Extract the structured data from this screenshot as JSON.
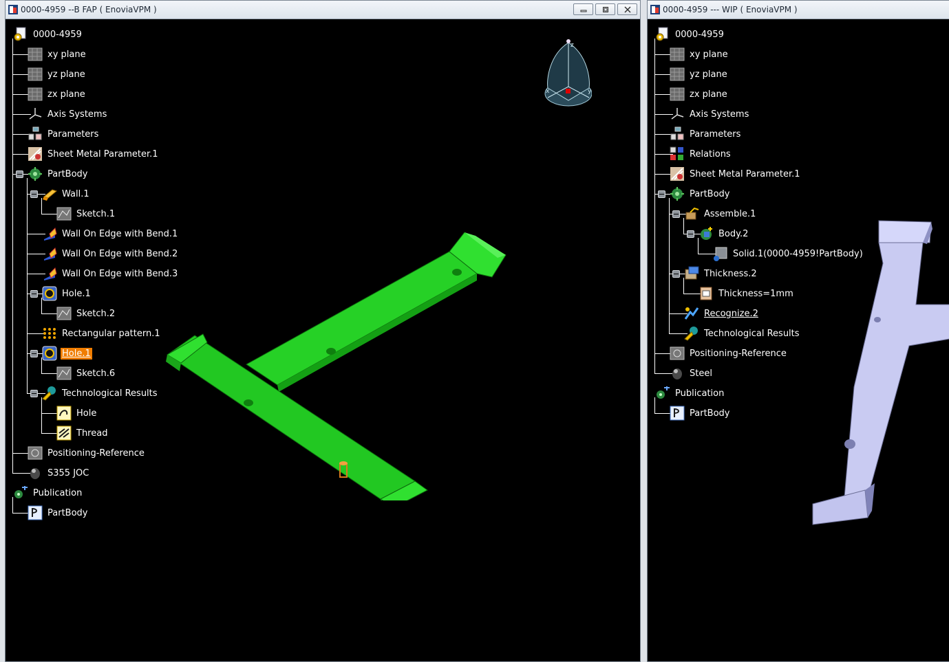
{
  "left_window": {
    "title": "0000-4959 --B FAP ( EnoviaVPM )",
    "tree": [
      {
        "label": "0000-4959",
        "icon": "part-icon",
        "depth": 0
      },
      {
        "label": "xy plane",
        "icon": "plane-icon",
        "depth": 1
      },
      {
        "label": "yz plane",
        "icon": "plane-icon",
        "depth": 1
      },
      {
        "label": "zx plane",
        "icon": "plane-icon",
        "depth": 1
      },
      {
        "label": "Axis Systems",
        "icon": "axis-icon",
        "depth": 1
      },
      {
        "label": "Parameters",
        "icon": "parameters-icon",
        "depth": 1
      },
      {
        "label": "Sheet Metal Parameter.1",
        "icon": "sheet-metal-param-icon",
        "depth": 1
      },
      {
        "label": "PartBody",
        "icon": "partbody-icon",
        "depth": 1
      },
      {
        "label": "Wall.1",
        "icon": "wall-icon",
        "depth": 2
      },
      {
        "label": "Sketch.1",
        "icon": "sketch-icon",
        "depth": 3
      },
      {
        "label": "Wall On Edge with Bend.1",
        "icon": "wall-edge-icon",
        "depth": 2
      },
      {
        "label": "Wall On Edge with Bend.2",
        "icon": "wall-edge-icon",
        "depth": 2
      },
      {
        "label": "Wall On Edge with Bend.3",
        "icon": "wall-edge-icon",
        "depth": 2
      },
      {
        "label": "Hole.1",
        "icon": "hole-icon",
        "depth": 2
      },
      {
        "label": "Sketch.2",
        "icon": "sketch-icon",
        "depth": 3
      },
      {
        "label": "Rectangular pattern.1",
        "icon": "pattern-icon",
        "depth": 2
      },
      {
        "label": "Hole.1",
        "icon": "hole-icon",
        "depth": 2,
        "highlight": true
      },
      {
        "label": "Sketch.6",
        "icon": "sketch-icon",
        "depth": 3
      },
      {
        "label": "Technological Results",
        "icon": "tech-results-icon",
        "depth": 2
      },
      {
        "label": "Hole",
        "icon": "hole-feature-icon",
        "depth": 3
      },
      {
        "label": "Thread",
        "icon": "thread-icon",
        "depth": 3
      },
      {
        "label": "Positioning-Reference",
        "icon": "positioning-icon",
        "depth": 1
      },
      {
        "label": "S355 JOC",
        "icon": "material-icon",
        "depth": 1
      },
      {
        "label": "Publication",
        "icon": "publication-icon",
        "depth": 0
      },
      {
        "label": "PartBody",
        "icon": "publication-item-icon",
        "depth": 1
      }
    ]
  },
  "right_window": {
    "title": "0000-4959 --- WIP ( EnoviaVPM )",
    "tree": [
      {
        "label": "0000-4959",
        "icon": "part-icon",
        "depth": 0
      },
      {
        "label": "xy plane",
        "icon": "plane-icon",
        "depth": 1
      },
      {
        "label": "yz plane",
        "icon": "plane-icon",
        "depth": 1
      },
      {
        "label": "zx plane",
        "icon": "plane-icon",
        "depth": 1
      },
      {
        "label": "Axis Systems",
        "icon": "axis-icon",
        "depth": 1
      },
      {
        "label": "Parameters",
        "icon": "parameters-icon",
        "depth": 1
      },
      {
        "label": "Relations",
        "icon": "relations-icon",
        "depth": 1
      },
      {
        "label": "Sheet Metal Parameter.1",
        "icon": "sheet-metal-param-icon",
        "depth": 1
      },
      {
        "label": "PartBody",
        "icon": "partbody-icon",
        "depth": 1
      },
      {
        "label": "Assemble.1",
        "icon": "assemble-icon",
        "depth": 2
      },
      {
        "label": "Body.2",
        "icon": "body-icon",
        "depth": 3
      },
      {
        "label": "Solid.1(0000-4959!PartBody)",
        "icon": "solid-icon",
        "depth": 4
      },
      {
        "label": "Thickness.2",
        "icon": "thickness-icon",
        "depth": 2
      },
      {
        "label": "Thickness=1mm",
        "icon": "thickness-param-icon",
        "depth": 3
      },
      {
        "label": "Recognize.2",
        "icon": "recognize-icon",
        "depth": 2,
        "underline": true
      },
      {
        "label": "Technological Results",
        "icon": "tech-results-icon",
        "depth": 2
      },
      {
        "label": "Positioning-Reference",
        "icon": "positioning-icon",
        "depth": 1
      },
      {
        "label": "Steel",
        "icon": "material-icon",
        "depth": 1
      },
      {
        "label": "Publication",
        "icon": "publication-icon",
        "depth": 0
      },
      {
        "label": "PartBody",
        "icon": "publication-item-icon",
        "depth": 1
      }
    ]
  },
  "compass": {
    "x_label": "x",
    "y_label": "y",
    "z_label": "z"
  },
  "colors": {
    "viewport_bg": "#000000",
    "part_fap": "#22cc22",
    "part_wip": "#c7c9ef",
    "highlight": "#f07d00",
    "tree_text": "#ffffff"
  }
}
